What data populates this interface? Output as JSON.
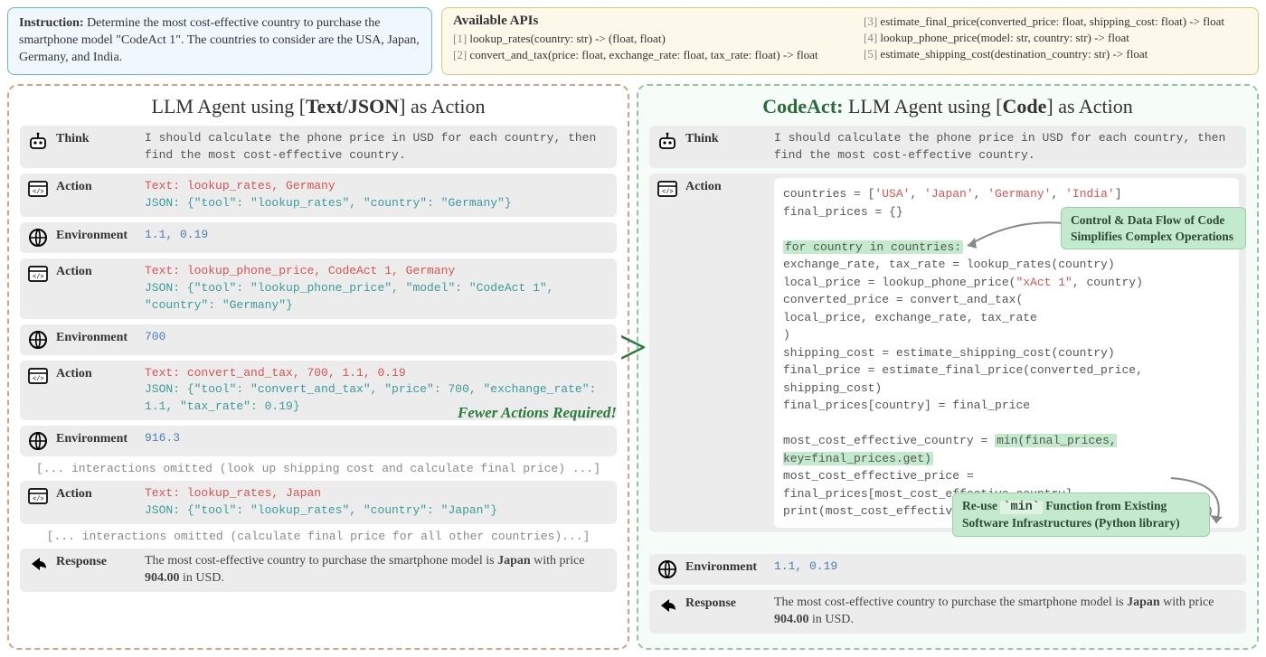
{
  "instruction": {
    "label": "Instruction:",
    "text": "Determine the most cost-effective country to purchase the smartphone model \"CodeAct 1\". The countries to consider are the USA, Japan, Germany, and India."
  },
  "apis": {
    "title": "Available APIs",
    "col1": [
      {
        "idx": "[1]",
        "sig": "lookup_rates(country: str) -> (float, float)"
      },
      {
        "idx": "[2]",
        "sig": "convert_and_tax(price: float, exchange_rate: float, tax_rate: float) -> float"
      }
    ],
    "col2": [
      {
        "idx": "[3]",
        "sig": "estimate_final_price(converted_price: float, shipping_cost: float) -> float"
      },
      {
        "idx": "[4]",
        "sig": "lookup_phone_price(model: str, country: str) -> float"
      },
      {
        "idx": "[5]",
        "sig": "estimate_shipping_cost(destination_country: str) -> float"
      }
    ]
  },
  "left": {
    "title_pre": "LLM Agent using [",
    "title_bold": "Text/JSON",
    "title_post": "] as Action",
    "think_label": "Think",
    "think_body": "I should calculate the phone price in USD for each country, then find the most cost-effective country.",
    "action_label": "Action",
    "env_label": "Environment",
    "response_label": "Response",
    "a1_text_pre": "Text:",
    "a1_text_val": " lookup_rates, Germany",
    "a1_json_pre": "JSON:",
    "a1_json_val": " {\"tool\": \"lookup_rates\", \"country\": \"Germany\"}",
    "env1": "1.1, 0.19",
    "a2_text_pre": "Text:",
    "a2_text_val": " lookup_phone_price, CodeAct 1, Germany",
    "a2_json_pre": "JSON:",
    "a2_json_val": " {\"tool\": \"lookup_phone_price\", \"model\": \"CodeAct 1\", \"country\": \"Germany\"}",
    "env2": "700",
    "a3_text_pre": "Text:",
    "a3_text_val": " convert_and_tax, 700, 1.1, 0.19",
    "a3_json_pre": "JSON:",
    "a3_json_val": " {\"tool\": \"convert_and_tax\", \"price\": 700, \"exchange_rate\": 1.1, \"tax_rate\": 0.19}",
    "env3": "916.3",
    "omit1": "[... interactions omitted (look up shipping cost and calculate final price) ...]",
    "a4_text_pre": "Text:",
    "a4_text_val": " lookup_rates, Japan",
    "a4_json_pre": "JSON:",
    "a4_json_val": " {\"tool\": \"lookup_rates\", \"country\": \"Japan\"}",
    "omit2": "[... interactions omitted (calculate final price for all other countries)...]",
    "response_pre": "The most cost-effective country to purchase the smartphone model is ",
    "response_b1": "Japan",
    "response_mid": " with price ",
    "response_b2": "904.00",
    "response_post": " in USD."
  },
  "right": {
    "title_codeact": "CodeAct:",
    "title_pre": " LLM Agent using [",
    "title_bold": "Code",
    "title_post": "] as Action",
    "think_label": "Think",
    "think_body": "I should calculate the phone price in USD for each country, then find the most cost-effective country.",
    "action_label": "Action",
    "env_label": "Environment",
    "env_val": "1.1, 0.19",
    "response_label": "Response",
    "response_pre": "The most cost-effective country to purchase the smartphone model is ",
    "response_b1": "Japan",
    "response_mid": " with price ",
    "response_b2": "904.00",
    "response_post": " in USD.",
    "code": {
      "l1a": "countries = [",
      "l1b": "'USA'",
      "l1c": ", ",
      "l1d": "'Japan'",
      "l1e": ", ",
      "l1f": "'Germany'",
      "l1g": ", ",
      "l1h": "'India'",
      "l1i": "]",
      "l2": "final_prices = {}",
      "l3": "",
      "l4": "for country in countries:",
      "l5": "    exchange_rate, tax_rate = lookup_rates(country)",
      "l6a": "    local_price = lookup_phone_price(",
      "l6b": "\"xAct 1\"",
      "l6c": ", country)",
      "l7": "    converted_price = convert_and_tax(",
      "l8": "        local_price, exchange_rate, tax_rate",
      "l9": "    )",
      "l10": "    shipping_cost = estimate_shipping_cost(country)",
      "l11": "    final_price = estimate_final_price(converted_price, shipping_cost)",
      "l12": "    final_prices[country] = final_price",
      "l13": "",
      "l14a": "most_cost_effective_country = ",
      "l14b": "min(final_prices, key=final_prices.get)",
      "l15": "most_cost_effective_price = final_prices[most_cost_effective_country]",
      "l16": "print(most_cost_effective_country, most_cost_effective_price)"
    },
    "callout1_l1": "Control & Data Flow of Code",
    "callout1_l2": "Simplifies Complex Operations",
    "callout2_l1a": "Re-use ",
    "callout2_code": "`min`",
    "callout2_l1b": " Function from Existing",
    "callout2_l2": "Software Infrastructures (Python library)"
  },
  "center": {
    "gt": ">",
    "fewer": "Fewer Actions Required!"
  }
}
